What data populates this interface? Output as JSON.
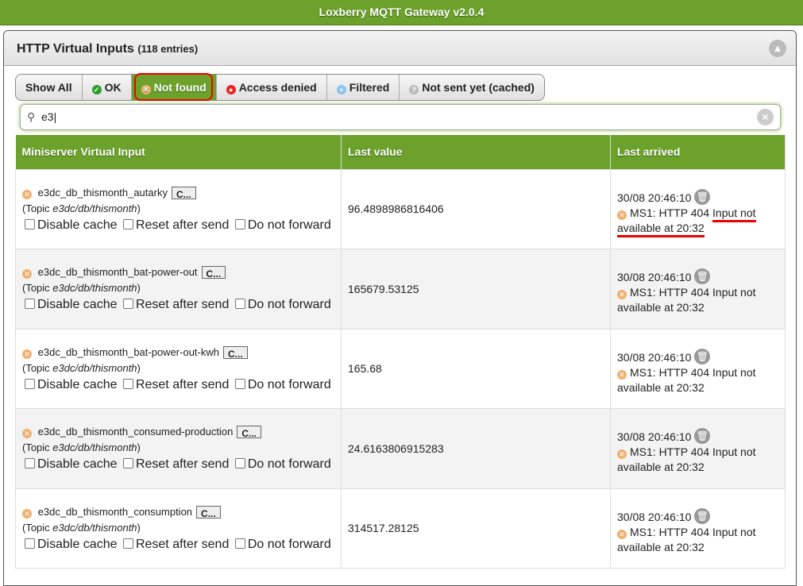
{
  "title": "Loxberry MQTT Gateway v2.0.4",
  "panel": {
    "title": "HTTP Virtual Inputs",
    "count": "(118 entries)"
  },
  "filters": [
    {
      "label": "Show All"
    },
    {
      "label": "OK",
      "icon": "check-icon"
    },
    {
      "label": "Not found",
      "icon": "x-circle-icon",
      "active": true
    },
    {
      "label": "Access denied",
      "icon": "lock-icon"
    },
    {
      "label": "Filtered",
      "icon": "filter-icon"
    },
    {
      "label": "Not sent yet (cached)",
      "icon": "question-icon"
    }
  ],
  "search": {
    "value": "e3"
  },
  "table": {
    "headers": [
      "Miniserver Virtual Input",
      "Last value",
      "Last arrived"
    ],
    "option_labels": {
      "disable_cache": "Disable cache",
      "reset": "Reset after send",
      "forward": "Do not forward"
    },
    "topic_prefix": "(Topic ",
    "topic_suffix": ")",
    "cbtn": "C...",
    "rows": [
      {
        "name": "e3dc_db_thismonth_autarky",
        "topic": "e3dc/db/thismonth",
        "value": "96.4898986816406",
        "time": "30/08 20:46:10",
        "msg": "MS1: HTTP 404 ",
        "msg2": "Input not available at 20:32"
      },
      {
        "name": "e3dc_db_thismonth_bat-power-out",
        "topic": "e3dc/db/thismonth",
        "value": "165679.53125",
        "time": "30/08 20:46:10",
        "msg": "MS1: HTTP 404 ",
        "msg2": "Input not available at 20:32"
      },
      {
        "name": "e3dc_db_thismonth_bat-power-out-kwh",
        "topic": "e3dc/db/thismonth",
        "value": "165.68",
        "time": "30/08 20:46:10",
        "msg": "MS1: HTTP 404 ",
        "msg2": "Input not available at 20:32"
      },
      {
        "name": "e3dc_db_thismonth_consumed-production",
        "topic": "e3dc/db/thismonth",
        "value": "24.6163806915283",
        "time": "30/08 20:46:10",
        "msg": "MS1: HTTP 404 ",
        "msg2": "Input not available at 20:32"
      },
      {
        "name": "e3dc_db_thismonth_consumption",
        "topic": "e3dc/db/thismonth",
        "value": "314517.28125",
        "time": "30/08 20:46:10",
        "msg": "MS1: HTTP 404 ",
        "msg2": "Input not available at 20:32"
      }
    ]
  }
}
